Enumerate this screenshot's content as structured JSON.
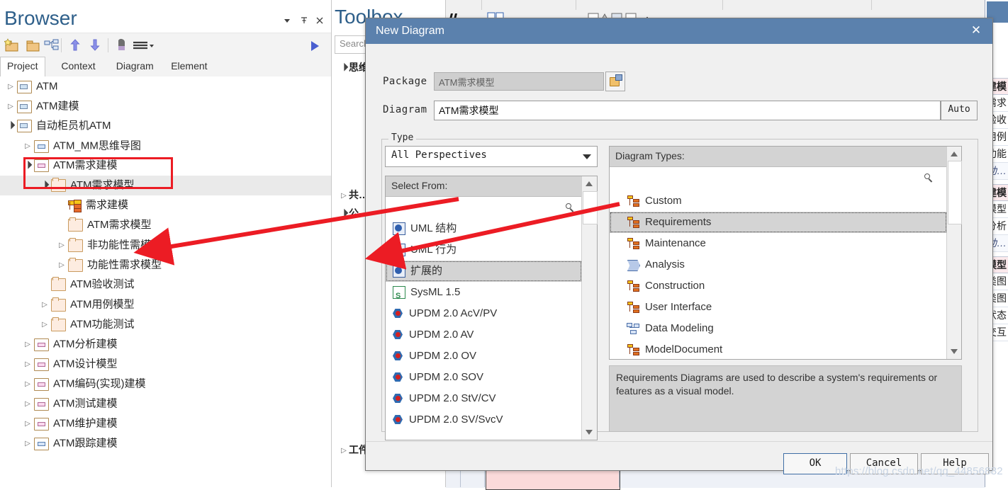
{
  "browser": {
    "title": "Browser",
    "window_buttons": [
      {
        "name": "dropdown-icon",
        "glyph": "▼"
      },
      {
        "name": "pin-icon",
        "glyph": "╤"
      },
      {
        "name": "close-icon",
        "glyph": "✕"
      }
    ],
    "toolbar_icons": [
      "new-package-icon",
      "folder-icon",
      "model-structure-icon",
      "move-up-icon",
      "move-down-icon",
      "pointer-icon",
      "menu-icon",
      "run-icon"
    ],
    "tabs": [
      {
        "label": "Project",
        "active": true
      },
      {
        "label": "Context",
        "active": false
      },
      {
        "label": "Diagram",
        "active": false
      },
      {
        "label": "Element",
        "active": false
      }
    ],
    "tree": [
      {
        "label": "ATM",
        "indent": 0,
        "twisty": "collapsed",
        "icon": "package",
        "selected": false
      },
      {
        "label": "ATM建模",
        "indent": 0,
        "twisty": "collapsed",
        "icon": "package",
        "selected": false
      },
      {
        "label": "自动柜员机ATM",
        "indent": 0,
        "twisty": "expanded",
        "icon": "package",
        "selected": false
      },
      {
        "label": "ATM_MM思维导图",
        "indent": 1,
        "twisty": "collapsed",
        "icon": "view-blue",
        "selected": false
      },
      {
        "label": "ATM需求建模",
        "indent": 1,
        "twisty": "expanded",
        "icon": "view-pink",
        "selected": false
      },
      {
        "label": "ATM需求模型",
        "indent": 2,
        "twisty": "expanded",
        "icon": "folder",
        "selected": true
      },
      {
        "label": "需求建模",
        "indent": 3,
        "twisty": "none",
        "icon": "requirements",
        "selected": false
      },
      {
        "label": "ATM需求模型",
        "indent": 3,
        "twisty": "none",
        "icon": "folder",
        "selected": false
      },
      {
        "label": "非功能性需模型",
        "indent": 3,
        "twisty": "collapsed",
        "icon": "folder",
        "selected": false
      },
      {
        "label": "功能性需求模型",
        "indent": 3,
        "twisty": "collapsed",
        "icon": "folder",
        "selected": false
      },
      {
        "label": "ATM验收测试",
        "indent": 2,
        "twisty": "none",
        "icon": "folder",
        "selected": false
      },
      {
        "label": "ATM用例模型",
        "indent": 2,
        "twisty": "collapsed",
        "icon": "folder",
        "selected": false
      },
      {
        "label": "ATM功能测试",
        "indent": 2,
        "twisty": "collapsed",
        "icon": "folder",
        "selected": false
      },
      {
        "label": "ATM分析建模",
        "indent": 1,
        "twisty": "collapsed",
        "icon": "view-pink",
        "selected": false
      },
      {
        "label": "ATM设计模型",
        "indent": 1,
        "twisty": "collapsed",
        "icon": "view-pink",
        "selected": false
      },
      {
        "label": "ATM编码(实现)建模",
        "indent": 1,
        "twisty": "collapsed",
        "icon": "view-pink",
        "selected": false
      },
      {
        "label": "ATM测试建模",
        "indent": 1,
        "twisty": "collapsed",
        "icon": "view-pink",
        "selected": false
      },
      {
        "label": "ATM维护建模",
        "indent": 1,
        "twisty": "collapsed",
        "icon": "view-pink",
        "selected": false
      },
      {
        "label": "ATM跟踪建模",
        "indent": 1,
        "twisty": "collapsed",
        "icon": "view-blue",
        "selected": false
      }
    ]
  },
  "toolbox": {
    "title": "Toolbox",
    "search_placeholder": "Search",
    "items": [
      {
        "label": "思维",
        "twisty": "expanded"
      },
      {
        "label": "共…",
        "twisty": "collapsed"
      },
      {
        "label": "公…",
        "twisty": "expanded"
      },
      {
        "label": "工件",
        "twisty": "collapsed"
      }
    ]
  },
  "right_panel": {
    "groups": [
      {
        "header": "建模",
        "items": [
          "需求",
          "验收",
          "用例",
          "功能"
        ],
        "italic": "动…"
      },
      {
        "header": "建模",
        "items": [
          "模型",
          "分析"
        ],
        "italic": "动…"
      },
      {
        "header": "模型",
        "items": [
          "类图",
          "类图",
          "状态",
          "交互"
        ],
        "italic": ""
      }
    ]
  },
  "dialog": {
    "title": "New Diagram",
    "close_glyph": "✕",
    "package": {
      "label": "Package",
      "value": "ATM需求模型",
      "browse_icon": "folder-browse-icon"
    },
    "diagram": {
      "label": "Diagram",
      "value": "ATM需求模型",
      "auto_label": "Auto"
    },
    "type_group_label": "Type",
    "perspective": {
      "selected": "All Perspectives",
      "options": [
        "All Perspectives"
      ]
    },
    "select_from": {
      "header": "Select From:",
      "search_icon": "search-icon",
      "items": [
        {
          "label": "UML 结构",
          "icon": "uml",
          "selected": false
        },
        {
          "label": "UML 行为",
          "icon": "uml",
          "selected": false
        },
        {
          "label": "扩展的",
          "icon": "uml",
          "selected": true
        },
        {
          "label": "SysML 1.5",
          "icon": "sysml",
          "selected": false
        },
        {
          "label": "UPDM 2.0 AcV/PV",
          "icon": "updm",
          "selected": false
        },
        {
          "label": "UPDM 2.0 AV",
          "icon": "updm",
          "selected": false
        },
        {
          "label": "UPDM 2.0 OV",
          "icon": "updm",
          "selected": false
        },
        {
          "label": "UPDM 2.0 SOV",
          "icon": "updm",
          "selected": false
        },
        {
          "label": "UPDM 2.0 StV/CV",
          "icon": "updm",
          "selected": false
        },
        {
          "label": "UPDM 2.0 SV/SvcV",
          "icon": "updm",
          "selected": false
        }
      ]
    },
    "diagram_types": {
      "header": "Diagram Types:",
      "search_icon": "search-icon",
      "items": [
        {
          "label": "Custom",
          "icon": "requirements",
          "selected": false
        },
        {
          "label": "Requirements",
          "icon": "requirements",
          "selected": true
        },
        {
          "label": "Maintenance",
          "icon": "requirements",
          "selected": false
        },
        {
          "label": "Analysis",
          "icon": "analysis",
          "selected": false
        },
        {
          "label": "Construction",
          "icon": "requirements",
          "selected": false
        },
        {
          "label": "User Interface",
          "icon": "requirements",
          "selected": false
        },
        {
          "label": "Data Modeling",
          "icon": "data-modeling",
          "selected": false
        },
        {
          "label": "ModelDocument",
          "icon": "requirements",
          "selected": false
        }
      ]
    },
    "description": "Requirements Diagrams are used to describe a system's requirements or features as a visual model.",
    "buttons": {
      "ok": "OK",
      "cancel": "Cancel",
      "help": "Help"
    }
  },
  "annotations": {
    "highlight_color": "#ec1c24",
    "arrow_count": 2
  },
  "watermark": "https://blog.csdn.net/qq_44856882",
  "colors": {
    "dialog_titlebar": "#5b81ad",
    "selection_gray": "#d4d4d4",
    "annotation_red": "#ec1c24",
    "browser_title_blue": "#2e5f8a"
  }
}
